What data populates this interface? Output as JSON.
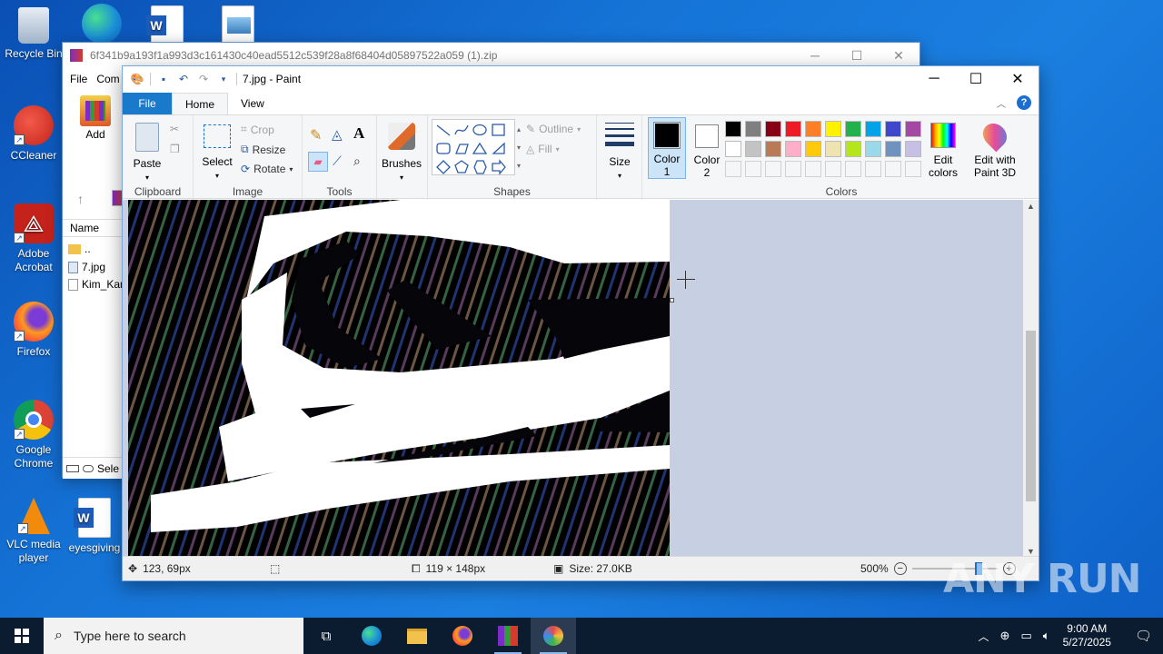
{
  "desktop": {
    "icons": [
      {
        "label": "Recycle Bin"
      },
      {
        "label": "CCleaner"
      },
      {
        "label": "Adobe Acrobat"
      },
      {
        "label": "Firefox"
      },
      {
        "label": "Google Chrome"
      },
      {
        "label": "VLC media player"
      },
      {
        "label": "eyesgiving"
      }
    ]
  },
  "winrar": {
    "title": "6f341b9a193f1a993d3c161430c40ead5512c539f28a8f68404d05897522a059 (1).zip",
    "menu": [
      "File",
      "Com"
    ],
    "add_label": "Add",
    "column_name": "Name",
    "files": [
      "..",
      "7.jpg",
      "Kim_Kar"
    ],
    "status_label": "Sele"
  },
  "paint": {
    "title": "7.jpg - Paint",
    "tabs": {
      "file": "File",
      "home": "Home",
      "view": "View"
    },
    "clipboard": {
      "paste": "Paste",
      "group": "Clipboard"
    },
    "image": {
      "select": "Select",
      "crop": "Crop",
      "resize": "Resize",
      "rotate": "Rotate",
      "group": "Image"
    },
    "tools": {
      "group": "Tools"
    },
    "brushes": {
      "label": "Brushes"
    },
    "shapes": {
      "outline": "Outline",
      "fill": "Fill",
      "group": "Shapes"
    },
    "size": {
      "label": "Size"
    },
    "colors": {
      "color1": "Color 1",
      "color1_line1": "Color",
      "color1_line2": "1",
      "color2_line1": "Color",
      "color2_line2": "2",
      "edit_colors_line1": "Edit",
      "edit_colors_line2": "colors",
      "paint3d_line1": "Edit with",
      "paint3d_line2": "Paint 3D",
      "group": "Colors",
      "palette_row1": [
        "#000000",
        "#7f7f7f",
        "#880015",
        "#ed1c24",
        "#ff7f27",
        "#fff200",
        "#22b14c",
        "#00a2e8",
        "#3f48cc",
        "#a349a4"
      ],
      "palette_row2": [
        "#ffffff",
        "#c3c3c3",
        "#b97a57",
        "#ffaec9",
        "#ffc90e",
        "#efe4b0",
        "#b5e61d",
        "#99d9ea",
        "#7092be",
        "#c8bfe7"
      ],
      "primary": "#000000",
      "secondary": "#ffffff"
    },
    "status": {
      "cursor": "123, 69px",
      "image_size": "119 × 148px",
      "file_size": "Size: 27.0KB",
      "zoom": "500%",
      "zoom_level": 0.8
    }
  },
  "taskbar": {
    "search_placeholder": "Type here to search",
    "time": "9:00 AM",
    "date": "5/27/2025"
  },
  "watermark": "ANY RUN"
}
